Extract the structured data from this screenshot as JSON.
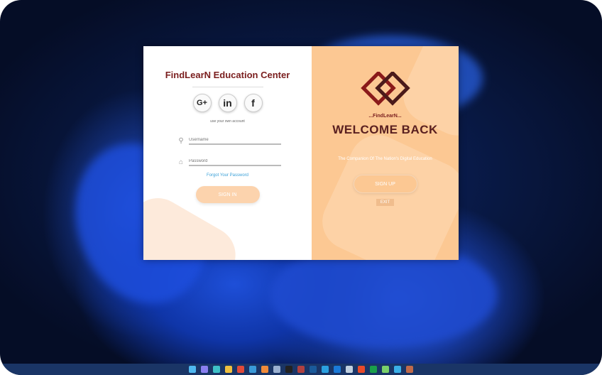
{
  "login": {
    "title": "FindLearN Education Center",
    "social": [
      {
        "icon": "google-plus-icon",
        "label": "G+"
      },
      {
        "icon": "linkedin-icon",
        "label": "in"
      },
      {
        "icon": "facebook-icon",
        "label": "f"
      }
    ],
    "hint": "use your own account",
    "username_placeholder": "Username",
    "password_placeholder": "Password",
    "forgot": "Forgot Your Password",
    "signin": "SIGN IN"
  },
  "welcome": {
    "logo_text": "...FindLearN...",
    "heading": "WELCOME BACK",
    "tagline": "The Companion Of The Nation's Digital Education",
    "signup": "SIGN UP",
    "exit": "EXIT"
  },
  "taskbar": {
    "colors": [
      "#4fb8f0",
      "#8a7ff0",
      "#3ec0c8",
      "#f0c040",
      "#e04a3a",
      "#3a9ad8",
      "#f08a3a",
      "#9ab0d0",
      "#222222",
      "#b04040",
      "#1a5a9a",
      "#2aa0e0",
      "#1a7ad8",
      "#c0d0e0",
      "#e84a2a",
      "#1aa04a",
      "#7ad06a",
      "#3ab0e8",
      "#c06a4a"
    ]
  }
}
